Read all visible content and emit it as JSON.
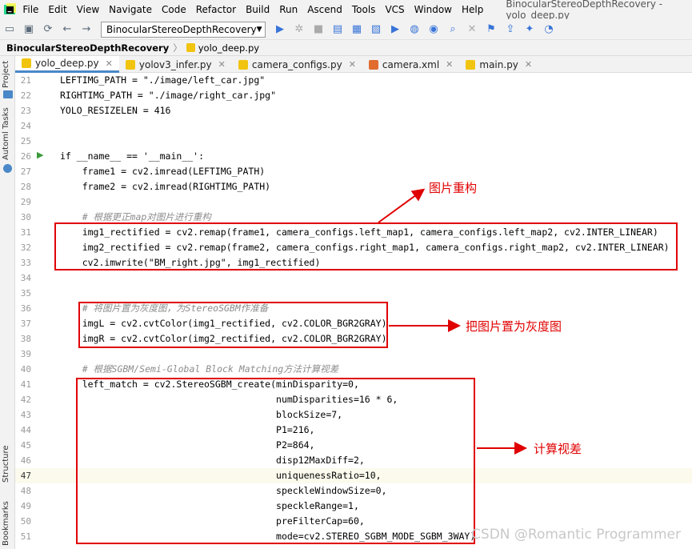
{
  "menu": {
    "items": [
      "File",
      "Edit",
      "View",
      "Navigate",
      "Code",
      "Refactor",
      "Build",
      "Run",
      "Ascend",
      "Tools",
      "VCS",
      "Window",
      "Help"
    ],
    "window_title": "BinocularStereoDepthRecovery - yolo_deep.py"
  },
  "toolbar": {
    "run_config": "BinocularStereoDepthRecovery"
  },
  "breadcrumb": {
    "project": "BinocularStereoDepthRecovery",
    "file": "yolo_deep.py"
  },
  "side_labels": {
    "project": "Project",
    "automl": "Automl Tasks",
    "structure": "Structure",
    "bookmarks": "Bookmarks"
  },
  "tabs": [
    {
      "label": "yolo_deep.py",
      "active": true
    },
    {
      "label": "yolov3_infer.py"
    },
    {
      "label": "camera_configs.py"
    },
    {
      "label": "camera.xml"
    },
    {
      "label": "main.py"
    }
  ],
  "code_lines": [
    {
      "num": "21",
      "text": "LEFTIMG_PATH = \"./image/left_car.jpg\""
    },
    {
      "num": "22",
      "text": "RIGHTIMG_PATH = \"./image/right_car.jpg\""
    },
    {
      "num": "23",
      "text": "YOLO_RESIZELEN = 416"
    },
    {
      "num": "24",
      "text": ""
    },
    {
      "num": "25",
      "text": ""
    },
    {
      "num": "26",
      "text": "if __name__ == '__main__':"
    },
    {
      "num": "27",
      "text": "    frame1 = cv2.imread(LEFTIMG_PATH)"
    },
    {
      "num": "28",
      "text": "    frame2 = cv2.imread(RIGHTIMG_PATH)"
    },
    {
      "num": "29",
      "text": ""
    },
    {
      "num": "30",
      "text": "    # 根据更正map对图片进行重构"
    },
    {
      "num": "31",
      "text": "    img1_rectified = cv2.remap(frame1, camera_configs.left_map1, camera_configs.left_map2, cv2.INTER_LINEAR)"
    },
    {
      "num": "32",
      "text": "    img2_rectified = cv2.remap(frame2, camera_configs.right_map1, camera_configs.right_map2, cv2.INTER_LINEAR)"
    },
    {
      "num": "33",
      "text": "    cv2.imwrite(\"BM_right.jpg\", img1_rectified)"
    },
    {
      "num": "34",
      "text": ""
    },
    {
      "num": "35",
      "text": ""
    },
    {
      "num": "36",
      "text": "    # 将图片置为灰度图，为StereoSGBM作准备"
    },
    {
      "num": "37",
      "text": "    imgL = cv2.cvtColor(img1_rectified, cv2.COLOR_BGR2GRAY)"
    },
    {
      "num": "38",
      "text": "    imgR = cv2.cvtColor(img2_rectified, cv2.COLOR_BGR2GRAY)"
    },
    {
      "num": "39",
      "text": ""
    },
    {
      "num": "40",
      "text": "    # 根据SGBM/Semi-Global Block Matching方法计算视差"
    },
    {
      "num": "41",
      "text": "    left_match = cv2.StereoSGBM_create(minDisparity=0,"
    },
    {
      "num": "42",
      "text": "                                       numDisparities=16 * 6,"
    },
    {
      "num": "43",
      "text": "                                       blockSize=7,"
    },
    {
      "num": "44",
      "text": "                                       P1=216,"
    },
    {
      "num": "45",
      "text": "                                       P2=864,"
    },
    {
      "num": "46",
      "text": "                                       disp12MaxDiff=2,"
    },
    {
      "num": "47",
      "text": "                                       uniquenessRatio=10,"
    },
    {
      "num": "48",
      "text": "                                       speckleWindowSize=0,"
    },
    {
      "num": "49",
      "text": "                                       speckleRange=1,"
    },
    {
      "num": "50",
      "text": "                                       preFilterCap=60,"
    },
    {
      "num": "51",
      "text": "                                       mode=cv2.STEREO_SGBM_MODE_SGBM_3WAY)"
    }
  ],
  "annotations": {
    "remap": "图片重构",
    "gray": "把图片置为灰度图",
    "disparity": "计算视差"
  },
  "watermark": "CSDN @Romantic Programmer",
  "colors": {
    "annotation": "#e00000",
    "keyword": "#0033b3",
    "string": "#067d17",
    "number": "#1750eb",
    "function": "#00627a"
  }
}
